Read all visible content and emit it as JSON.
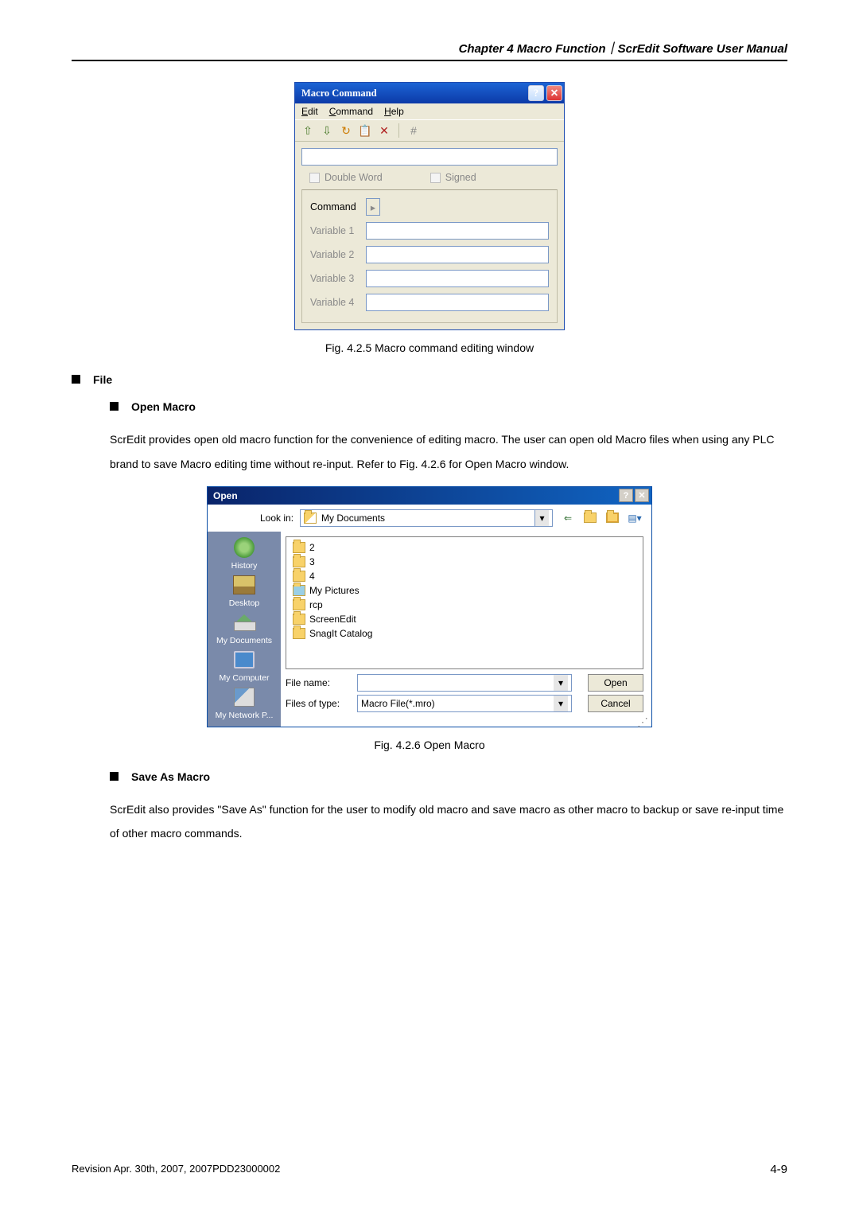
{
  "header": "Chapter 4  Macro Function｜ScrEdit Software User Manual",
  "fig425": {
    "title": "Macro Command",
    "menu": {
      "edit": "Edit",
      "command": "Command",
      "help": "Help"
    },
    "toolbar": {
      "up": "⇧",
      "down": "⇩",
      "update": "↻",
      "paste": "📋",
      "delete": "✕",
      "hash": "#"
    },
    "chk_double_word": "Double Word",
    "chk_signed": "Signed",
    "rows": {
      "command": "Command",
      "v1": "Variable 1",
      "v2": "Variable 2",
      "v3": "Variable 3",
      "v4": "Variable 4"
    },
    "caption": "Fig. 4.2.5 Macro command editing window"
  },
  "sec_file": "File",
  "sec_open_macro": {
    "heading": "Open Macro",
    "body": "ScrEdit provides open old macro function for the convenience of editing macro. The user can open old Macro files when using any PLC brand to save Macro editing time without re-input. Refer to Fig. 4.2.6 for Open Macro window."
  },
  "fig426": {
    "title": "Open",
    "lookin_label": "Look in:",
    "lookin_value": "My Documents",
    "sidebar": {
      "history": "History",
      "desktop": "Desktop",
      "mydocs": "My Documents",
      "mycomp": "My Computer",
      "mynet": "My Network P..."
    },
    "files": [
      "2",
      "3",
      "4",
      "My Pictures",
      "rcp",
      "ScreenEdit",
      "SnagIt Catalog"
    ],
    "file_name_label": "File name:",
    "file_name_value": "",
    "file_type_label": "Files of type:",
    "file_type_value": "Macro File(*.mro)",
    "open_btn": "Open",
    "cancel_btn": "Cancel",
    "caption": "Fig. 4.2.6 Open Macro"
  },
  "sec_save_as": {
    "heading": "Save As Macro",
    "body": "ScrEdit also provides \"Save As\" function for the user to modify old macro and save macro as other macro to backup or save re-input time of other macro commands."
  },
  "footer": {
    "rev": "Revision Apr. 30th, 2007, 2007PDD23000002",
    "page": "4-9"
  }
}
